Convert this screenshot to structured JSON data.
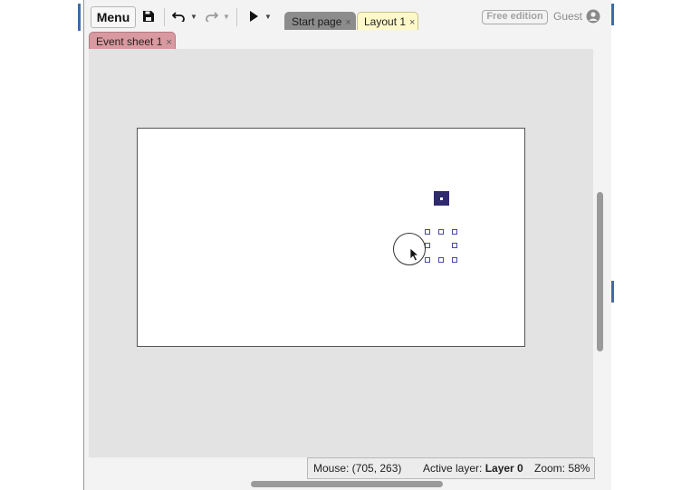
{
  "toolbar": {
    "menu_label": "Menu",
    "icons": [
      "save-icon",
      "undo-icon",
      "redo-icon",
      "play-icon"
    ],
    "free_edition_label": "Free edition",
    "guest_label": "Guest"
  },
  "tabs": [
    {
      "label": "Start page",
      "close": "×",
      "active": false
    },
    {
      "label": "Layout 1",
      "close": "×",
      "active": true
    },
    {
      "label": "Event sheet 1",
      "close": "×",
      "active": false
    }
  ],
  "status": {
    "mouse": "Mouse: (705, 263)",
    "active_layer_prefix": "Active layer: ",
    "active_layer_name": "Layer 0",
    "zoom": "Zoom: 58%"
  },
  "colors": {
    "accent": "#3b6ea5",
    "selected_object": "#2f2a6e",
    "layout_tab": "#fff8c9",
    "event_tab": "#d89aa0"
  }
}
